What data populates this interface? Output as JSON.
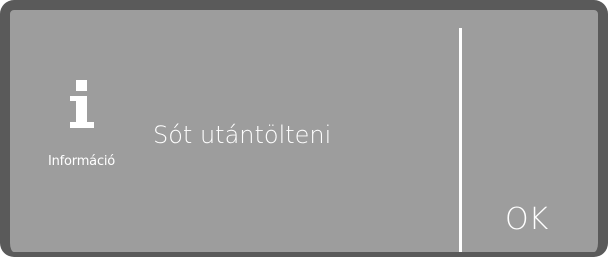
{
  "dialog": {
    "icon_name": "info-icon",
    "icon_label": "Információ",
    "message": "Sót utántölteni",
    "ok_label": "OK"
  },
  "colors": {
    "frame": "#5a5a5a",
    "panel": "#9d9d9d",
    "text": "#ffffff"
  }
}
